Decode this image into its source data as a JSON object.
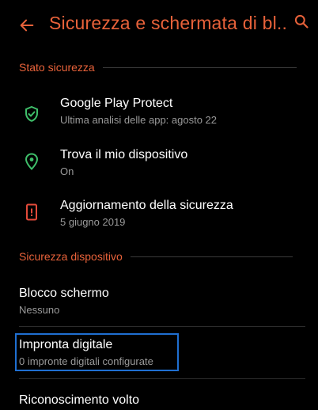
{
  "header": {
    "title": "Sicurezza e schermata di bl...",
    "back_icon": "arrow-left-icon",
    "search_icon": "search-icon"
  },
  "sections": [
    {
      "title": "Stato sicurezza",
      "items": [
        {
          "icon": "shield-check-icon",
          "title": "Google Play Protect",
          "subtitle": "Ultima analisi delle app: agosto 22"
        },
        {
          "icon": "location-pin-icon",
          "title": "Trova il mio dispositivo",
          "subtitle": "On"
        },
        {
          "icon": "phone-alert-icon",
          "title": "Aggiornamento della sicurezza",
          "subtitle": "5 giugno 2019"
        }
      ]
    },
    {
      "title": "Sicurezza dispositivo",
      "items": [
        {
          "title": "Blocco schermo",
          "subtitle": "Nessuno"
        },
        {
          "title": "Impronta digitale",
          "subtitle": "0 impronte digitali configurate"
        },
        {
          "title": "Riconoscimento volto"
        }
      ]
    }
  ],
  "colors": {
    "accent": "#e8623a",
    "icon_green": "#3fbf6a",
    "icon_red": "#e34a3a",
    "focus_outline": "#1f6fd1"
  }
}
